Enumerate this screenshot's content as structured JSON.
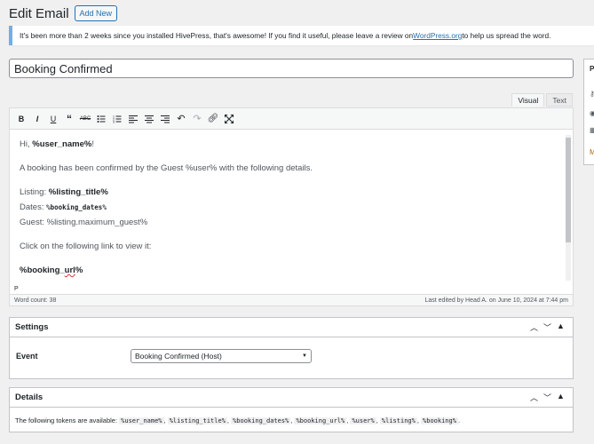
{
  "header": {
    "title": "Edit Email",
    "add_new": "Add New"
  },
  "notice": {
    "text_before": "It's been more than 2 weeks since you installed HivePress, that's awesome! If you find it useful, please leave a review on ",
    "link": "WordPress.org",
    "text_after": " to help us spread the word."
  },
  "post_title": "Booking Confirmed",
  "editor": {
    "tabs": [
      "Visual",
      "Text"
    ],
    "active_tab": "Visual",
    "toolbar_icons": [
      "bold-icon",
      "italic-icon",
      "underline-icon",
      "blockquote-icon",
      "strikethrough-icon",
      "bullet-list-icon",
      "numbered-list-icon",
      "align-left-icon",
      "align-center-icon",
      "align-right-icon",
      "undo-icon",
      "redo-icon",
      "link-icon",
      "fullscreen-icon"
    ],
    "content": {
      "greeting_prefix": "Hi, ",
      "greeting_token": "%user_name%",
      "greeting_suffix": "!",
      "line2": "A booking has been confirmed by the Guest  %user% with the following details.",
      "listing_label": "Listing: ",
      "listing_token": "%listing_title%",
      "dates_label": "Dates: ",
      "dates_token": "%booking_dates%",
      "guest_line": "Guest: %listing.maximum_guest%",
      "click_line": "Click on the following link to view it:",
      "url_token_a": "%booking_",
      "url_token_b": "url",
      "url_token_c": "%"
    },
    "path": "P",
    "word_count": "Word count: 38",
    "last_edited": "Last edited by Head A. on June 10, 2024 at 7:44 pm"
  },
  "settings": {
    "title": "Settings",
    "event_label": "Event",
    "event_value": "Booking Confirmed (Host)"
  },
  "details": {
    "title": "Details",
    "intro": "The following tokens are available: ",
    "tokens": [
      "%user_name%",
      "%listing_title%",
      "%booking_dates%",
      "%booking_url%",
      "%user%",
      "%listing%",
      "%booking%"
    ],
    "end": "."
  },
  "side_panel": {
    "label": "P"
  },
  "colors": {
    "accent": "#2271b1",
    "notice_border": "#72aee6",
    "background": "#f0f0f1"
  }
}
